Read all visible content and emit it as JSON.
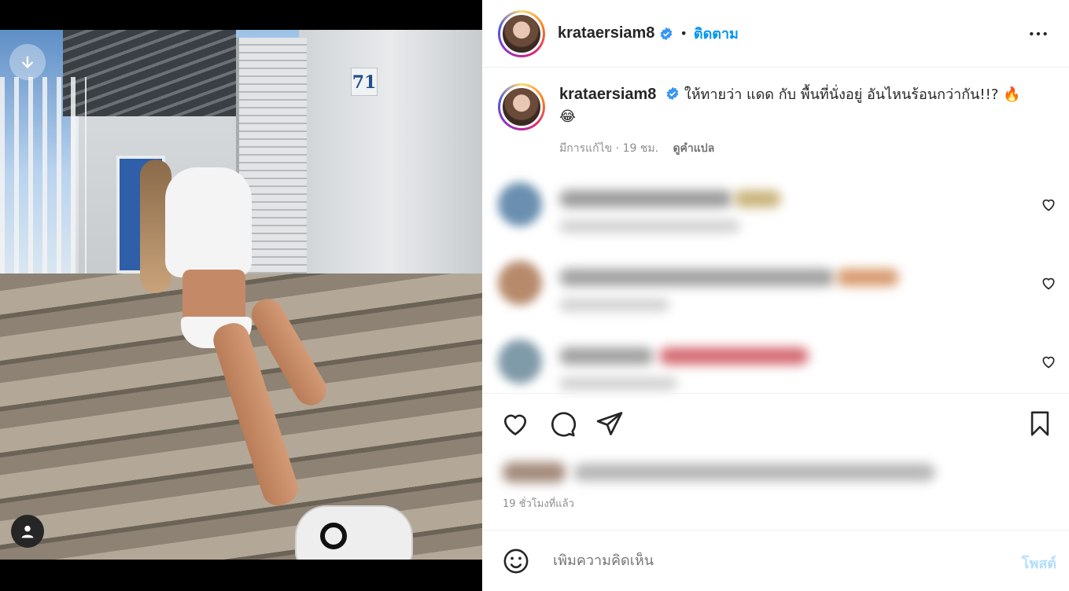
{
  "post": {
    "username": "krataersiam8",
    "follow_label": "ติดตาม",
    "dot": "•",
    "caption_text": "ให้ทายว่า แดด กับ พื้นที่นั่งอยู่ อันไหนร้อนกว่ากัน!!? 🔥😂",
    "edited_label": "มีการแก้ไข",
    "separator": "·",
    "age_short": "19 ชม.",
    "see_translation": "ดูคำแปล",
    "timestamp": "19 ชั่วโมงที่แล้ว",
    "add_comment_placeholder": "เพิ่มความคิดเห็น",
    "post_button": "โพสต์",
    "house_number": "71"
  },
  "icons": {
    "verified": "verified-badge-icon",
    "more": "more-options-icon",
    "heart": "heart-icon",
    "comment": "comment-icon",
    "share": "share-icon",
    "bookmark": "bookmark-icon",
    "emoji": "emoji-icon",
    "media_down": "chevron-down-icon",
    "media_user": "user-tag-icon"
  },
  "colors": {
    "link": "#0095f6",
    "post_disabled": "#b2dffc",
    "muted": "#8e8e8e"
  }
}
